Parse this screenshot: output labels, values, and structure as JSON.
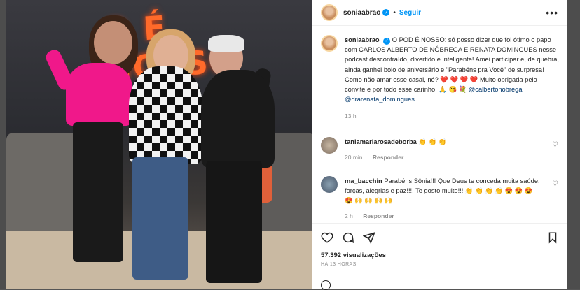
{
  "post": {
    "username": "soniaabrao",
    "follow_label": "Seguir",
    "neon_text": "O É NOSSO",
    "caption": {
      "username": "soniaabrao",
      "text": "O POD É NOSSO: só posso dizer que foi ótimo o papo com CARLOS ALBERTO DE NÓBREGA E RENATA DOMINGUES nesse podcast descontraído, divertido e inteligente! Amei participar e, de quebra, ainda ganhei bolo de aniversário e \"Parabéns pra Você\" de surpresa! Como não amar esse casal, né? ❤️ ❤️ ❤️ ❤️ Muito obrigada pelo convite e por todo esse carinho! 🙏 😘 💐",
      "mention1": "@calbertonobrega",
      "mention2": "@drarenata_domingues",
      "time": "13 h"
    },
    "comments": [
      {
        "username": "taniamariarosadeborba",
        "text": "👏 👏 👏",
        "time": "20 min",
        "reply_label": "Responder"
      },
      {
        "username": "ma_bacchin",
        "text": "Parabéns Sônia!!! Que Deus te conceda muita saúde, forças, alegrias e paz!!!! Te gosto muito!!! 👏 👏 👏 👏 😍 😍 😍 😍 🙌 🙌 🙌 🙌",
        "time": "2 h",
        "reply_label": "Responder"
      }
    ],
    "views": "57.392 visualizações",
    "posted_ago": "HÁ 13 HORAS",
    "colors": {
      "link": "#00376b",
      "follow": "#0095f6",
      "heart_red": "#ed4956"
    },
    "icons": [
      "heart-icon",
      "comment-icon",
      "share-icon",
      "bookmark-icon",
      "more-icon",
      "verified-icon",
      "smile-icon"
    ]
  }
}
